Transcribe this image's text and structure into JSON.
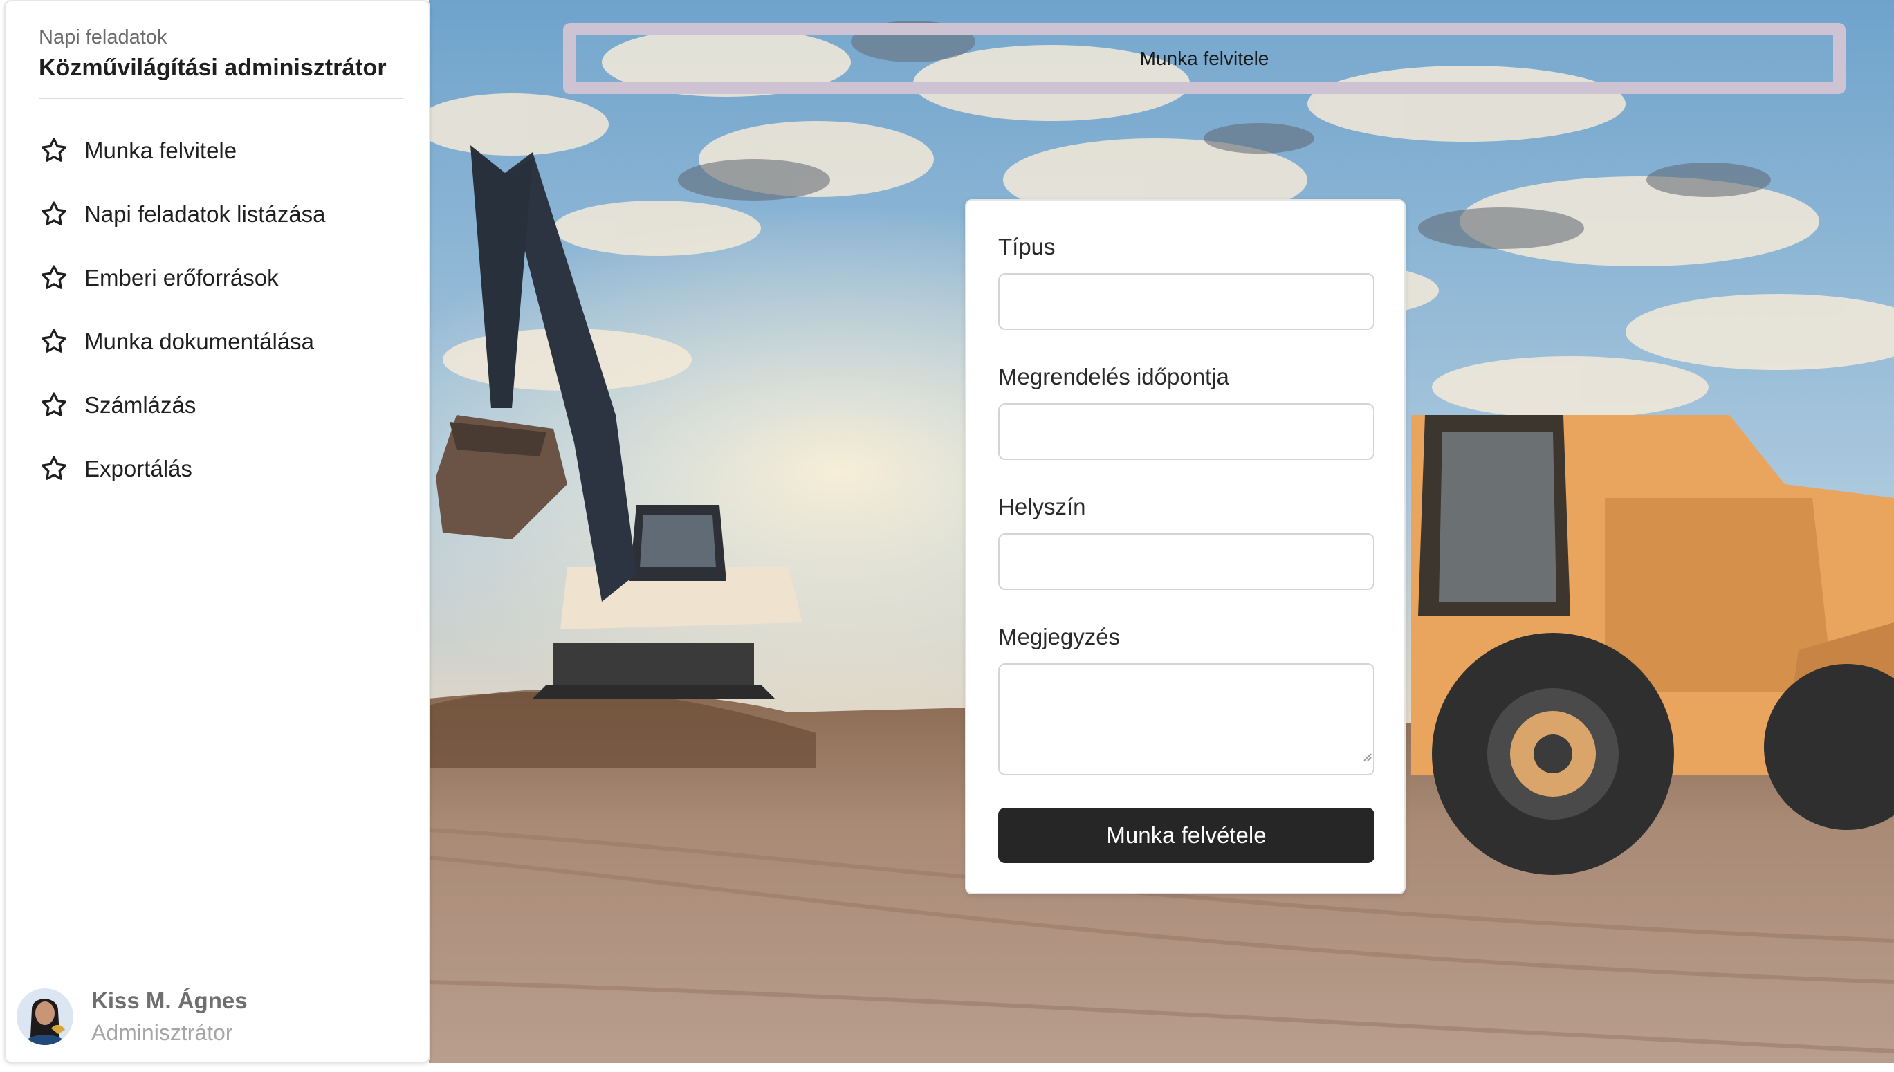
{
  "sidebar": {
    "subtitle": "Napi feladatok",
    "title": "Közművilágítási adminisztrátor",
    "items": [
      {
        "label": "Munka felvitele",
        "icon": "star-icon"
      },
      {
        "label": "Napi feladatok listázása",
        "icon": "star-icon"
      },
      {
        "label": "Emberi erőforrások",
        "icon": "star-icon"
      },
      {
        "label": "Munka dokumentálása",
        "icon": "star-icon"
      },
      {
        "label": "Számlázás",
        "icon": "star-icon"
      },
      {
        "label": "Exportálás",
        "icon": "star-icon"
      }
    ],
    "user": {
      "name": "Kiss M. Ágnes",
      "role": "Adminisztrátor"
    }
  },
  "banner": {
    "title": "Munka felvitele"
  },
  "form": {
    "fields": [
      {
        "label": "Típus",
        "value": ""
      },
      {
        "label": "Megrendelés időpontja",
        "value": ""
      },
      {
        "label": "Helyszín",
        "value": ""
      },
      {
        "label": "Megjegyzés",
        "value": ""
      }
    ],
    "submit_label": "Munka felvétele"
  },
  "colors": {
    "banner_border": "#cdc3d3",
    "submit_bg": "#262626",
    "sky": "#8fb6d6"
  }
}
